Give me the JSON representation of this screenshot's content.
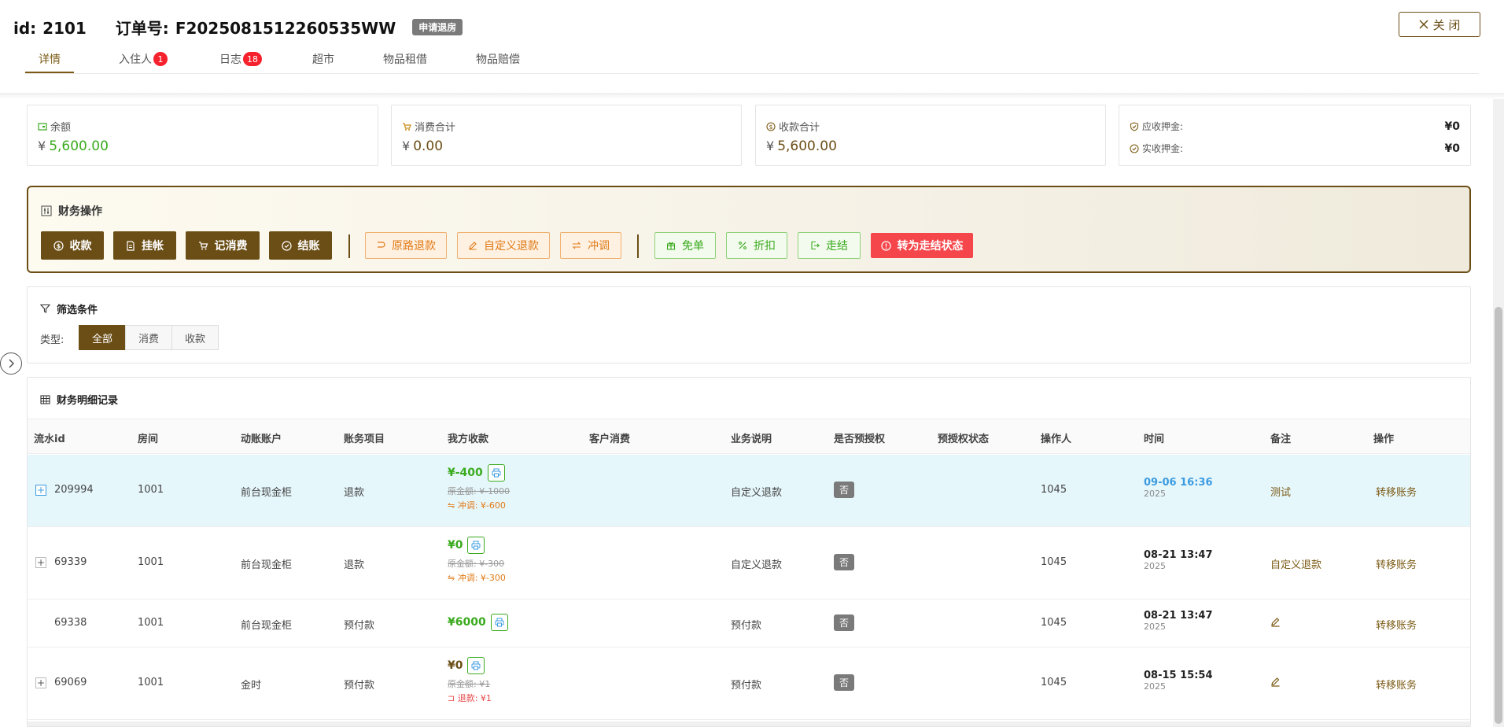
{
  "header": {
    "id_label": "id:",
    "id_value": "2101",
    "order_label": "订单号:",
    "order_value": "F2025081512260535WW",
    "status": "申请退房",
    "close_label": "关 闭"
  },
  "tabs": [
    {
      "label": "详情",
      "badge": ""
    },
    {
      "label": "入住人",
      "badge": "1"
    },
    {
      "label": "日志",
      "badge": "18"
    },
    {
      "label": "超市",
      "badge": ""
    },
    {
      "label": "物品租借",
      "badge": ""
    },
    {
      "label": "物品赔偿",
      "badge": ""
    }
  ],
  "stats": {
    "balance": {
      "label": "余额",
      "currency": "¥",
      "value": "5,600.00"
    },
    "consume": {
      "label": "消费合计",
      "currency": "¥",
      "value": "0.00"
    },
    "receipt": {
      "label": "收款合计",
      "currency": "¥",
      "value": "5,600.00"
    },
    "deposit": {
      "due_label": "应收押金:",
      "due_value": "¥0",
      "paid_label": "实收押金:",
      "paid_value": "¥0"
    }
  },
  "finance_ops": {
    "title": "财务操作",
    "primary": [
      "收款",
      "挂帐",
      "记消费",
      "结账"
    ],
    "refund": [
      "原路退款",
      "自定义退款",
      "冲调"
    ],
    "discount": [
      "免单",
      "折扣",
      "走结"
    ],
    "danger": "转为走结状态"
  },
  "filter": {
    "title": "筛选条件",
    "type_label": "类型:",
    "options": [
      "全部",
      "消费",
      "收款"
    ],
    "selected": "全部"
  },
  "table": {
    "title": "财务明细记录",
    "columns": [
      "流水id",
      "房间",
      "动账账户",
      "账务项目",
      "我方收款",
      "客户消费",
      "业务说明",
      "是否预授权",
      "预授权状态",
      "操作人",
      "时间",
      "备注",
      "操作"
    ],
    "rows": [
      {
        "id": "209994",
        "room": "1001",
        "account": "前台现金柜",
        "item": "退款",
        "amount": "¥-400",
        "orig": "原金额: ¥-1000",
        "extra": "冲调: ¥-600",
        "extra_type": "adjust",
        "consume": "",
        "desc": "自定义退款",
        "preauth": "否",
        "preauth_status": "",
        "operator": "1045",
        "time": "09-06 16:36",
        "year": "2025",
        "note": "测试",
        "op": "转移账务"
      },
      {
        "id": "69339",
        "room": "1001",
        "account": "前台现金柜",
        "item": "退款",
        "amount": "¥0",
        "orig": "原金额: ¥-300",
        "extra": "冲调: ¥-300",
        "extra_type": "adjust",
        "consume": "",
        "desc": "自定义退款",
        "preauth": "否",
        "preauth_status": "",
        "operator": "1045",
        "time": "08-21 13:47",
        "year": "2025",
        "note": "自定义退款",
        "op": "转移账务"
      },
      {
        "id": "69338",
        "room": "1001",
        "account": "前台现金柜",
        "item": "预付款",
        "amount": "¥6000",
        "orig": "",
        "extra": "",
        "extra_type": "",
        "consume": "",
        "desc": "预付款",
        "preauth": "否",
        "preauth_status": "",
        "operator": "1045",
        "time": "08-21 13:47",
        "year": "2025",
        "note": "",
        "op": "转移账务"
      },
      {
        "id": "69069",
        "room": "1001",
        "account": "金时",
        "item": "预付款",
        "amount": "¥0",
        "orig": "原金额: ¥1",
        "extra": "退款: ¥1",
        "extra_type": "refund",
        "consume": "",
        "desc": "预付款",
        "preauth": "否",
        "preauth_status": "",
        "operator": "1045",
        "time": "08-15 15:54",
        "year": "2025",
        "note": "",
        "op": "转移账务"
      }
    ]
  },
  "colors": {
    "brand": "#6b4e16",
    "green": "#3aaa1e",
    "orange": "#e07a16",
    "red": "#f5474b",
    "blue": "#3b9be0"
  }
}
